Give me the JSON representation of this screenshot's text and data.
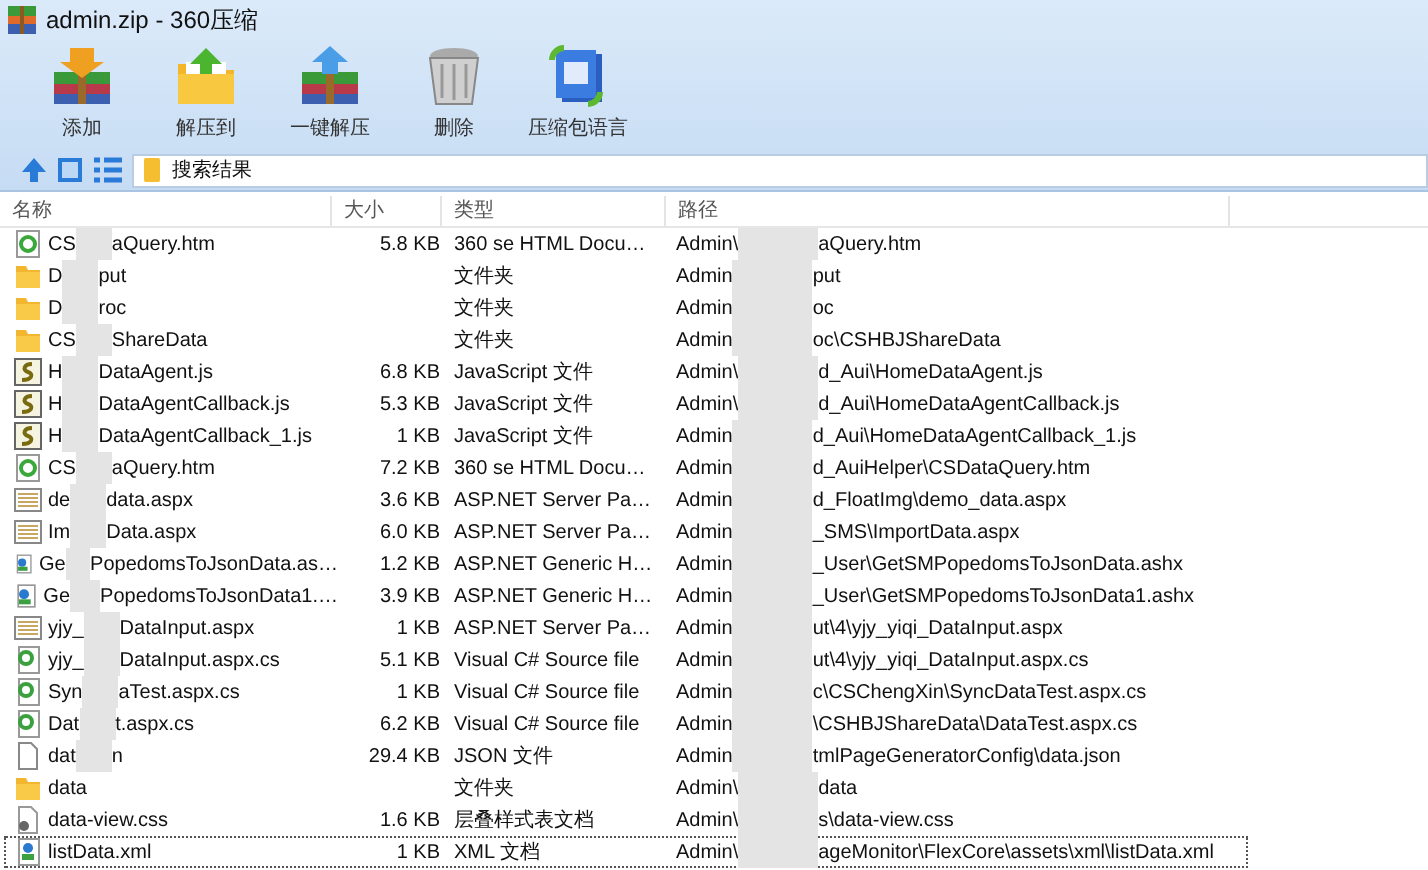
{
  "window": {
    "title": "admin.zip - 360压缩"
  },
  "toolbar": [
    {
      "label": "添加",
      "kind": "add"
    },
    {
      "label": "解压到",
      "kind": "extract"
    },
    {
      "label": "一键解压",
      "kind": "quick"
    },
    {
      "label": "删除",
      "kind": "delete"
    },
    {
      "label": "压缩包语言",
      "kind": "language"
    }
  ],
  "address": {
    "value": "搜索结果"
  },
  "table": {
    "columns": [
      "名称",
      "大小",
      "类型",
      "路径"
    ],
    "rows": [
      {
        "kind": "html",
        "name": [
          "CS",
          "aQuery.htm"
        ],
        "size": "5.8 KB",
        "type": "360 se HTML Docu…",
        "path": [
          "Admin\\",
          "aQuery.htm"
        ],
        "focused": false
      },
      {
        "kind": "folder",
        "name": [
          "D",
          "put"
        ],
        "type": "文件夹",
        "path": [
          "Admin",
          "put"
        ],
        "focused": false
      },
      {
        "kind": "folder",
        "name": [
          "D",
          "roc"
        ],
        "type": "文件夹",
        "path": [
          "Admin",
          "oc"
        ],
        "focused": false
      },
      {
        "kind": "folder",
        "name": [
          "CS",
          "ShareData"
        ],
        "type": "文件夹",
        "path": [
          "Admin",
          "oc\\CSHBJShareData"
        ],
        "focused": false
      },
      {
        "kind": "js",
        "name": [
          "H",
          "DataAgent.js"
        ],
        "size": "6.8 KB",
        "type": "JavaScript 文件",
        "path": [
          "Admin\\",
          "d_Aui\\HomeDataAgent.js"
        ],
        "focused": false
      },
      {
        "kind": "js",
        "name": [
          "H",
          "DataAgentCallback.js"
        ],
        "size": "5.3 KB",
        "type": "JavaScript 文件",
        "path": [
          "Admin\\",
          "d_Aui\\HomeDataAgentCallback.js"
        ],
        "focused": false
      },
      {
        "kind": "js",
        "name": [
          "H",
          "DataAgentCallback_1.js"
        ],
        "size": "1 KB",
        "type": "JavaScript 文件",
        "path": [
          "Admin",
          "d_Aui\\HomeDataAgentCallback_1.js"
        ],
        "focused": false
      },
      {
        "kind": "html",
        "name": [
          "CS",
          "aQuery.htm"
        ],
        "size": "7.2 KB",
        "type": "360 se HTML Docu…",
        "path": [
          "Admin",
          "d_AuiHelper\\CSDataQuery.htm"
        ],
        "focused": false
      },
      {
        "kind": "aspx",
        "name": [
          "de",
          "data.aspx"
        ],
        "size": "3.6 KB",
        "type": "ASP.NET Server Pa…",
        "path": [
          "Admin",
          "d_FloatImg\\demo_data.aspx"
        ],
        "focused": false
      },
      {
        "kind": "aspx",
        "name": [
          "Im",
          "Data.aspx"
        ],
        "size": "6.0 KB",
        "type": "ASP.NET Server Pa…",
        "path": [
          "Admin",
          "_SMS\\ImportData.aspx"
        ],
        "focused": false
      },
      {
        "kind": "ashx",
        "name": [
          "Ge",
          "PopedomsToJsonData.as…"
        ],
        "size": "1.2 KB",
        "type": "ASP.NET Generic H…",
        "path": [
          "Admin",
          "_User\\GetSMPopedomsToJsonData.ashx"
        ],
        "focused": false
      },
      {
        "kind": "ashx",
        "name": [
          "Ge",
          "PopedomsToJsonData1.…"
        ],
        "size": "3.9 KB",
        "type": "ASP.NET Generic H…",
        "path": [
          "Admin",
          "_User\\GetSMPopedomsToJsonData1.ashx"
        ],
        "focused": false
      },
      {
        "kind": "aspx",
        "name": [
          "yjy_",
          "DataInput.aspx"
        ],
        "size": "1 KB",
        "type": "ASP.NET Server Pa…",
        "path": [
          "Admin",
          "ut\\4\\yjy_yiqi_DataInput.aspx"
        ],
        "focused": false
      },
      {
        "kind": "cs",
        "name": [
          "yjy_",
          "DataInput.aspx.cs"
        ],
        "size": "5.1 KB",
        "type": "Visual C# Source file",
        "path": [
          "Admin",
          "ut\\4\\yjy_yiqi_DataInput.aspx.cs"
        ],
        "focused": false
      },
      {
        "kind": "cs",
        "name": [
          "Syn",
          "aTest.aspx.cs"
        ],
        "size": "1 KB",
        "type": "Visual C# Source file",
        "path": [
          "Admin",
          "c\\CSChengXin\\SyncDataTest.aspx.cs"
        ],
        "focused": false
      },
      {
        "kind": "cs",
        "name": [
          "Dat",
          "t.aspx.cs"
        ],
        "size": "6.2 KB",
        "type": "Visual C# Source file",
        "path": [
          "Admin",
          "\\CSHBJShareData\\DataTest.aspx.cs"
        ],
        "focused": false
      },
      {
        "kind": "file",
        "name": [
          "dat",
          "n"
        ],
        "size": "29.4 KB",
        "type": "JSON 文件",
        "path": [
          "Admin",
          "tmlPageGeneratorConfig\\data.json"
        ],
        "focused": false
      },
      {
        "kind": "folder",
        "name": [
          "data"
        ],
        "type": "文件夹",
        "path": [
          "Admin\\",
          "data"
        ],
        "focused": false
      },
      {
        "kind": "css",
        "name": [
          "data-view.css"
        ],
        "size": "1.6 KB",
        "type": "层叠样式表文档",
        "path": [
          "Admin\\",
          "s\\data-view.css"
        ],
        "focused": false
      },
      {
        "kind": "xml",
        "name": [
          "listData.xml"
        ],
        "size": "1 KB",
        "type": "XML 文档",
        "path": [
          "Admin\\",
          "ageMonitor\\FlexCore\\assets\\xml\\listData.xml"
        ],
        "focused": true
      }
    ]
  }
}
